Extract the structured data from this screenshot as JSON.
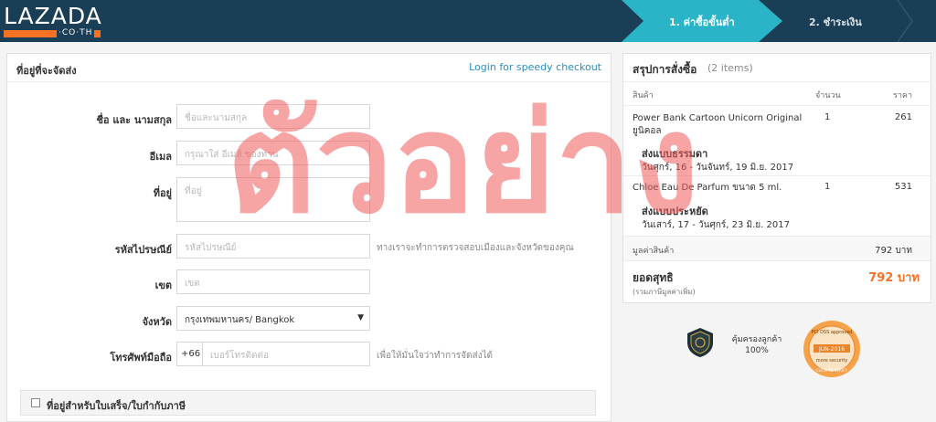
{
  "header": {
    "logo_text": "LAZADA",
    "logo_sub": "·CO·TH",
    "steps": [
      {
        "label": "1. ค่าซื้อขั้นต่ำ"
      },
      {
        "label": "2. ชำระเงิน"
      }
    ]
  },
  "address": {
    "title": "ที่อยู่ที่จะจัดส่ง",
    "login_link": "Login for speedy checkout",
    "fields": {
      "name": {
        "label": "ชื่อ และ นามสกุล",
        "placeholder": "ชื่อและนามสกุล"
      },
      "email": {
        "label": "อีเมล",
        "placeholder": "กรุณาใส่ อีเมล์ ของท่าน"
      },
      "address": {
        "label": "ที่อยู่",
        "placeholder": "ที่อยู่"
      },
      "postcode": {
        "label": "รหัสไปรษณีย์",
        "placeholder": "รหัสไปรษณีย์",
        "hint": "ทางเราจะทำการตรวจสอบเมืองและจังหวัดของคุณ"
      },
      "district": {
        "label": "เขต",
        "placeholder": "เขต"
      },
      "province": {
        "label": "จังหวัด",
        "value": "กรุงเทพมหานคร/ Bangkok"
      },
      "phone": {
        "label": "โทรศัพท์มือถือ",
        "prefix": "+66",
        "placeholder": "เบอร์โทรติดต่อ",
        "hint": "เพื่อให้มั่นใจว่าทำการจัดส่งได้"
      }
    },
    "tax_checkbox_label": "ที่อยู่สำหรับใบเสร็จ/ใบกำกับภาษี"
  },
  "summary": {
    "title": "สรุปการสั่งซื้อ",
    "count": "(2 items)",
    "col_product": "สินค้า",
    "col_qty": "จำนวน",
    "col_price": "ราคา",
    "items": [
      {
        "name": "Power Bank Cartoon Unicorn Original ยูนิคอล",
        "qty": "1",
        "price": "261",
        "ship_type": "ส่งแบบธรรมดา",
        "ship_date": "วันศุกร์, 16 - วันจันทร์, 19 มิ.ย. 2017"
      },
      {
        "name": "Chloe Eau De Parfum ขนาด 5 ml.",
        "qty": "1",
        "price": "531",
        "ship_type": "ส่งแบบประหยัด",
        "ship_date": "วันเสาร์, 17 - วันศุกร์, 23 มิ.ย. 2017"
      }
    ],
    "subtotal_label": "มูลค่าสินค้า",
    "subtotal_value": "792 บาท",
    "total_label": "ยอดสุทธิ",
    "total_note": "(รวมภาษีมูลค่าเพิ่ม)",
    "total_value": "792 บาท"
  },
  "trust": {
    "protect_text": "คุ้มครองลูกค้า 100%",
    "badge_line1": "PCI DSS approved",
    "badge_date": "JUN-2016",
    "badge_line3": "more security",
    "badge_line4": "CLICK TO VERIFY"
  },
  "watermark": "ตัวอย่าง",
  "colors": {
    "brand_orange": "#f57224",
    "header_bg": "#1a3e55",
    "step_active": "#2ab4c8",
    "link": "#2a8fbd"
  }
}
